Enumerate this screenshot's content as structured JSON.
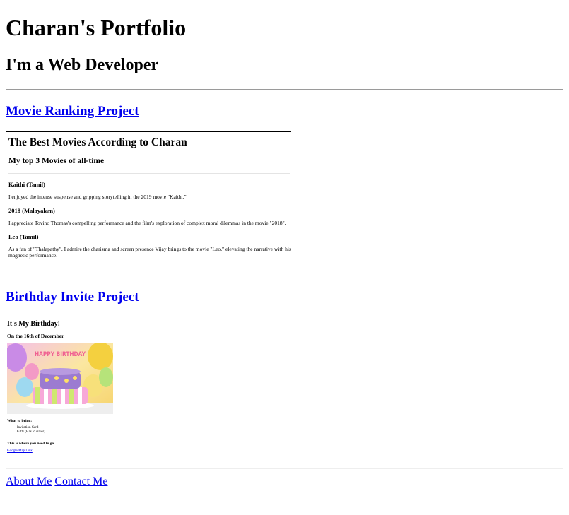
{
  "header": {
    "title": "Charan's Portfolio",
    "subtitle": "I'm a Web Developer"
  },
  "projects": {
    "movie_link": "Movie Ranking Project",
    "birthday_link": "Birthday Invite Project"
  },
  "movie": {
    "title": "The Best Movies According to Charan",
    "subtitle": "My top 3 Movies of all-time",
    "items": [
      {
        "name": "Kaithi (Tamil)",
        "desc": "I enjoyed the intense suspense and gripping storytelling in the 2019 movie \"Kaithi.\""
      },
      {
        "name": "2018 (Malayalam)",
        "desc": "I appreciate Tovino Thomas's compelling performance and the film's exploration of complex moral dilemmas in the movie \"2018\"."
      },
      {
        "name": "Leo (Tamil)",
        "desc": "As a fan of \"Thalapathy\", I admire the charisma and screen presence Vijay brings to the movie \"Leo,\" elevating the narrative with his magnetic performance."
      }
    ]
  },
  "birthday": {
    "title": "It's My Birthday!",
    "date": "On the 16th of December",
    "image_text": "HAPPY BIRTHDAY",
    "what_to_bring": "What to bring:",
    "items": [
      "Invitation Card",
      "Gifts (Has to silver)"
    ],
    "where_to_go": "This is where you need to go.",
    "map_link": "Google Map Link"
  },
  "footer": {
    "about": "About Me",
    "contact": "Contact Me"
  }
}
